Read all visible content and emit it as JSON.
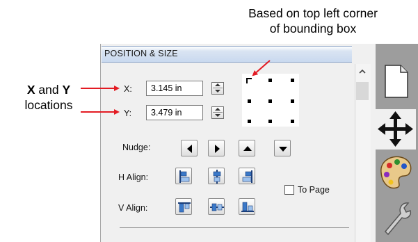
{
  "annotations": {
    "top_line1": "Based on top left corner",
    "top_line2": "of bounding box",
    "left_x": "X",
    "left_and": " and ",
    "left_y": "Y",
    "left_line2": "locations"
  },
  "panel": {
    "title": "POSITION & SIZE",
    "x_label": "X:",
    "x_value": "3.145 in",
    "y_label": "Y:",
    "y_value": "3.479 in",
    "nudge_label": "Nudge:",
    "h_align_label": "H Align:",
    "v_align_label": "V Align:",
    "to_page_label": "To Page",
    "to_page_checked": false
  },
  "side_tabs": [
    {
      "icon": "document-icon"
    },
    {
      "icon": "move-icon",
      "active": true
    },
    {
      "icon": "palette-icon"
    },
    {
      "icon": "wrench-icon"
    }
  ],
  "colors": {
    "annotation_red": "#e31b23",
    "header_blue": "#c9d9ef",
    "align_blue": "#3a78c8"
  }
}
